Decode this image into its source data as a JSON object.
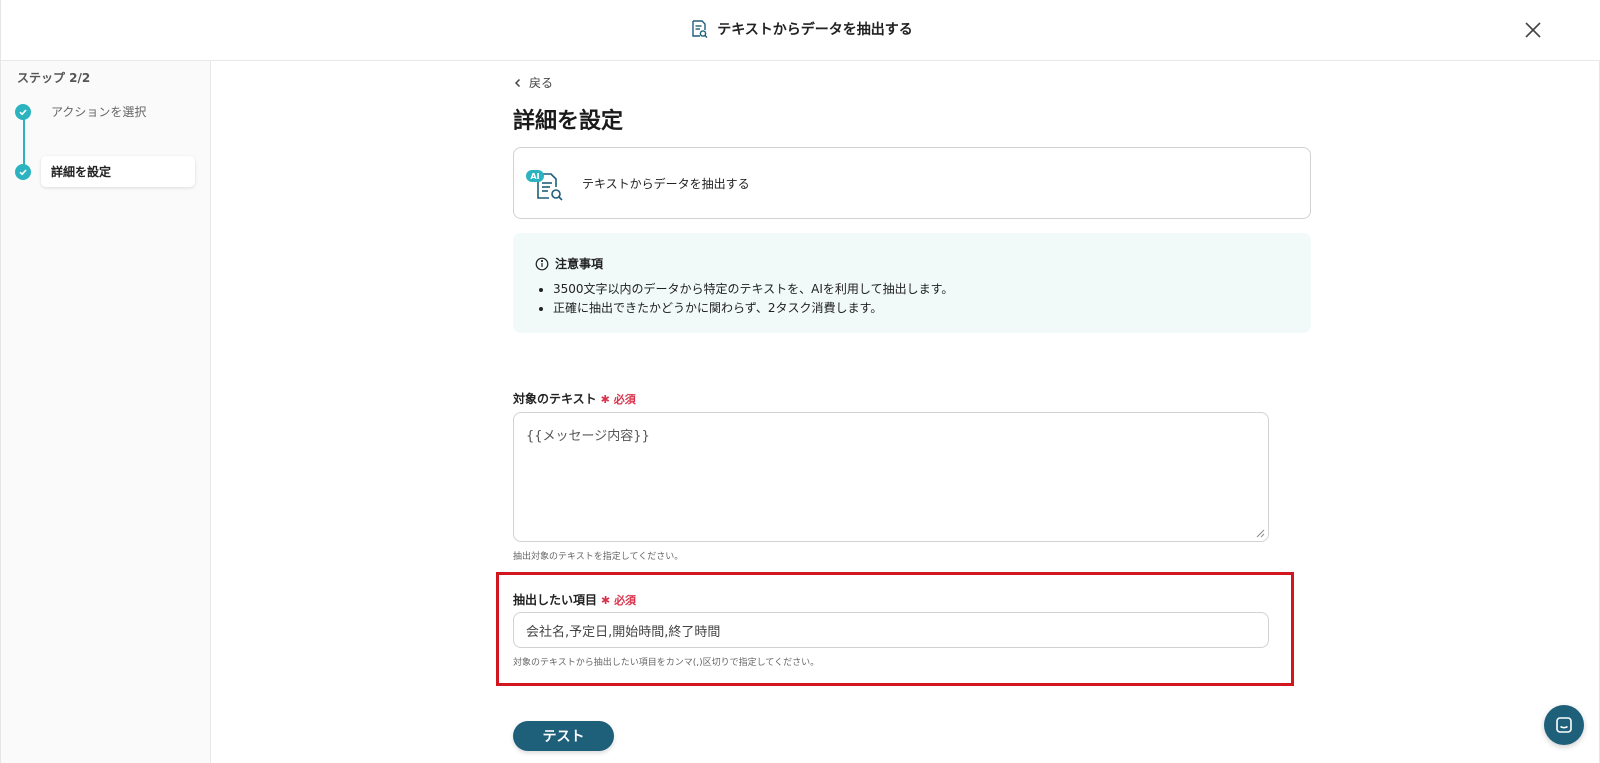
{
  "header": {
    "title": "テキストからデータを抽出する",
    "title_icon": "document-search-icon",
    "close_icon": "close-icon"
  },
  "sidebar": {
    "step_count": "ステップ 2/2",
    "steps": [
      {
        "label": "アクションを選択",
        "status": "completed"
      },
      {
        "label": "詳細を設定",
        "status": "current"
      }
    ]
  },
  "main": {
    "back_label": "戻る",
    "title": "詳細を設定",
    "action_card": {
      "badge": "AI",
      "label": "テキストからデータを抽出する"
    },
    "notice": {
      "title": "注意事項",
      "items": [
        "3500文字以内のデータから特定のテキストを、AIを利用して抽出します。",
        "正確に抽出できたかどうかに関わらず、2タスク消費します。"
      ]
    },
    "target_text": {
      "label": "対象のテキスト",
      "required": "必須",
      "value": "{{メッセージ内容}}",
      "hint": "抽出対象のテキストを指定してください。"
    },
    "extract_items": {
      "label": "抽出したい項目",
      "required": "必須",
      "value": "会社名,予定日,開始時間,終了時間",
      "hint": "対象のテキストから抽出したい項目をカンマ(,)区切りで指定してください。"
    },
    "test_button": "テスト"
  },
  "colors": {
    "accent": "#2bb3c0",
    "primary_button": "#1e5f7a",
    "required": "#d9344d",
    "highlight": "#d2161d",
    "notice_bg": "#f1faf9"
  }
}
